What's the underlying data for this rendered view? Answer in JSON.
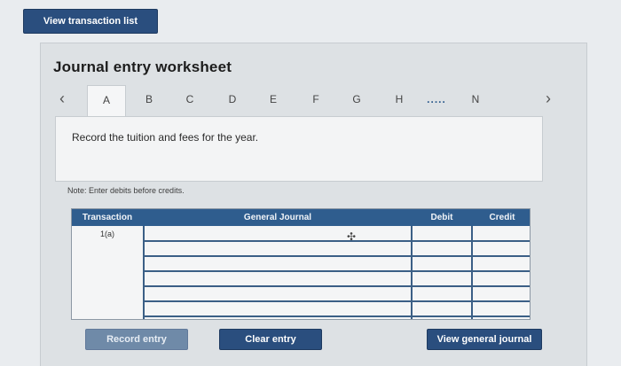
{
  "top_button": {
    "label": "View transaction list"
  },
  "worksheet": {
    "title": "Journal entry worksheet",
    "tabs": [
      "A",
      "B",
      "C",
      "D",
      "E",
      "F",
      "G",
      "H",
      ".....",
      "N"
    ],
    "active_tab": "A",
    "prompt": "Record the tuition and fees for the year.",
    "note": "Note: Enter debits before credits."
  },
  "table": {
    "headers": [
      "Transaction",
      "General Journal",
      "Debit",
      "Credit"
    ],
    "rows": [
      {
        "transaction": "1(a)",
        "general_journal": "",
        "debit": "",
        "credit": ""
      },
      {
        "transaction": "",
        "general_journal": "",
        "debit": "",
        "credit": ""
      },
      {
        "transaction": "",
        "general_journal": "",
        "debit": "",
        "credit": ""
      },
      {
        "transaction": "",
        "general_journal": "",
        "debit": "",
        "credit": ""
      },
      {
        "transaction": "",
        "general_journal": "",
        "debit": "",
        "credit": ""
      },
      {
        "transaction": "",
        "general_journal": "",
        "debit": "",
        "credit": ""
      }
    ]
  },
  "buttons": {
    "record_entry": "Record entry",
    "clear_entry": "Clear entry",
    "view_general_journal": "View general journal"
  },
  "colors": {
    "button_dark": "#2a4e7e",
    "table_header": "#2f5d8e",
    "button_disabled": "#6f8aa8"
  }
}
